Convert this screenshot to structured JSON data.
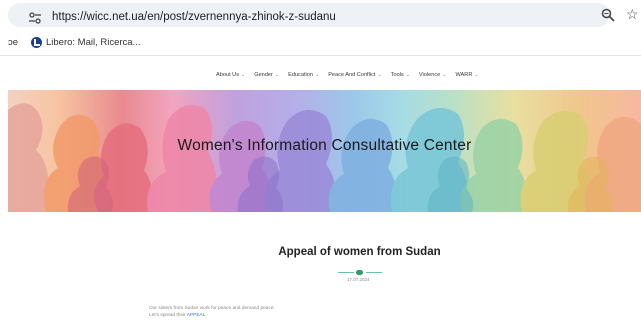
{
  "browser": {
    "url": "https://wicc.net.ua/en/post/zvernennya-zhinok-z-sudanu",
    "site_info_icon": "tune-icon",
    "zoom_icon": "magnifier-icon",
    "star_icon": "star-outline-icon",
    "star_glyph": "☆"
  },
  "bookmarks": {
    "cut_off_label": "ɔe",
    "libero_label": "Libero: Mail, Ricerca..."
  },
  "site_nav": {
    "items": [
      {
        "label": "About Us"
      },
      {
        "label": "Gender"
      },
      {
        "label": "Education"
      },
      {
        "label": "Peace And Conflict"
      },
      {
        "label": "Tools"
      },
      {
        "label": "Violence"
      },
      {
        "label": "WARR"
      }
    ],
    "chevron_glyph": "⌄"
  },
  "banner": {
    "title": "Women's Information Consultative Center"
  },
  "article": {
    "title": "Appeal of women from Sudan",
    "date": "17.07.2024",
    "body_line_1": "Our sisters from Sudan work for peace and demand peace.",
    "body_line_2_prefix": "Let's spread their",
    "body_line_2_link": "APPEAL"
  },
  "colors": {
    "accent_green": "#2e9b63",
    "link_blue": "#2e7fd6"
  }
}
